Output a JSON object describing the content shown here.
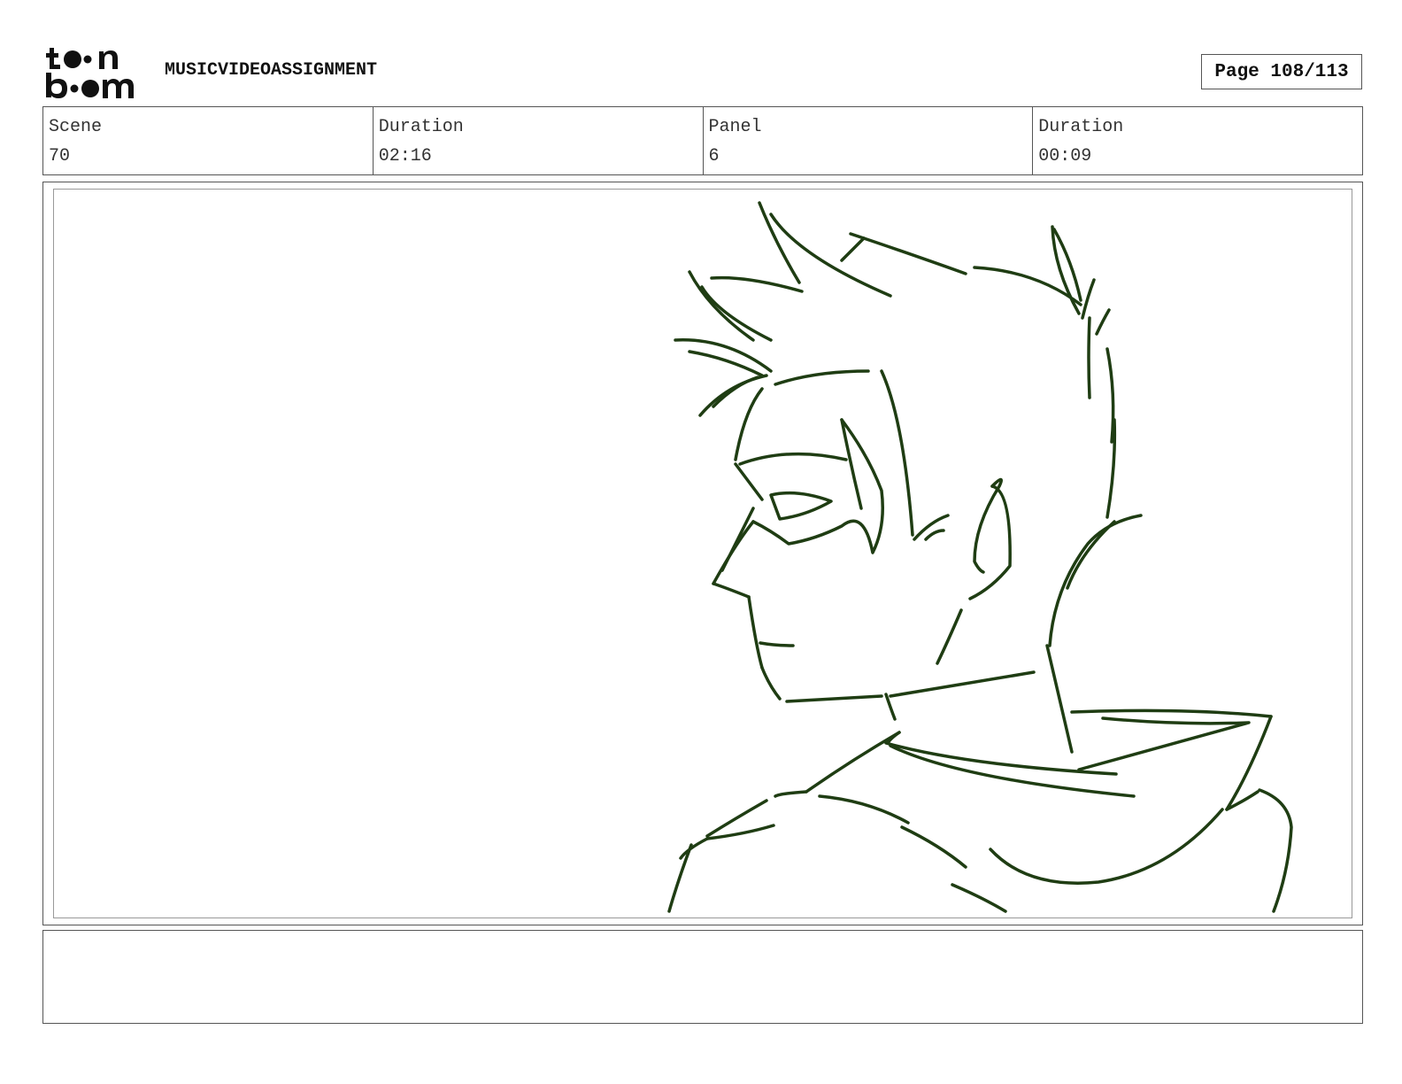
{
  "header": {
    "logo_icon": "toon-boom-logo",
    "project_title": "MUSICVIDEOASSIGNMENT",
    "page_label": "Page 108/113"
  },
  "info": {
    "scene_label": "Scene",
    "scene_value": "70",
    "scene_duration_label": "Duration",
    "scene_duration_value": "02:16",
    "panel_label": "Panel",
    "panel_value": "6",
    "panel_duration_label": "Duration",
    "panel_duration_value": "00:09"
  },
  "panel": {
    "sketch_icon": "character-sketch",
    "stroke_color": "#1f3d13"
  },
  "notes": {
    "text": ""
  }
}
